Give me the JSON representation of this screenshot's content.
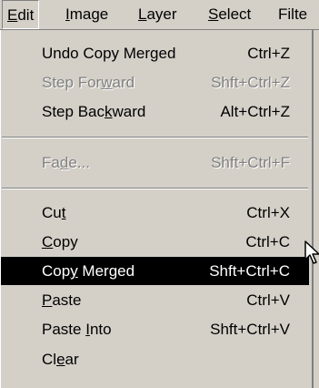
{
  "menubar": {
    "items": [
      {
        "label": "Edit",
        "pre": "",
        "key": "E",
        "post": "dit"
      },
      {
        "label": "Image",
        "pre": "",
        "key": "I",
        "post": "mage"
      },
      {
        "label": "Layer",
        "pre": "",
        "key": "L",
        "post": "ayer"
      },
      {
        "label": "Select",
        "pre": "",
        "key": "S",
        "post": "elect"
      },
      {
        "label": "Filter",
        "pre": "",
        "key": "",
        "post": "Filte"
      }
    ]
  },
  "edit_menu": {
    "items": [
      {
        "label": "Undo Copy Merged",
        "pre": "Undo Copy Merged",
        "key": "",
        "post": "",
        "shortcut": "Ctrl+Z",
        "state": "enabled"
      },
      {
        "label": "Step Forward",
        "pre": "Step For",
        "key": "w",
        "post": "ard",
        "shortcut": "Shft+Ctrl+Z",
        "state": "disabled"
      },
      {
        "label": "Step Backward",
        "pre": "Step Bac",
        "key": "k",
        "post": "ward",
        "shortcut": "Alt+Ctrl+Z",
        "state": "enabled"
      },
      {
        "label": "Fade...",
        "pre": "Fa",
        "key": "d",
        "post": "e...",
        "shortcut": "Shft+Ctrl+F",
        "state": "disabled"
      },
      {
        "label": "Cut",
        "pre": "Cu",
        "key": "t",
        "post": "",
        "shortcut": "Ctrl+X",
        "state": "enabled"
      },
      {
        "label": "Copy",
        "pre": "",
        "key": "C",
        "post": "opy",
        "shortcut": "Ctrl+C",
        "state": "enabled"
      },
      {
        "label": "Copy Merged",
        "pre": "Cop",
        "key": "y",
        "post": " Merged",
        "shortcut": "Shft+Ctrl+C",
        "state": "highlighted"
      },
      {
        "label": "Paste",
        "pre": "",
        "key": "P",
        "post": "aste",
        "shortcut": "Ctrl+V",
        "state": "enabled"
      },
      {
        "label": "Paste Into",
        "pre": "Paste ",
        "key": "I",
        "post": "nto",
        "shortcut": "Shft+Ctrl+V",
        "state": "enabled"
      },
      {
        "label": "Clear",
        "pre": "Cl",
        "key": "e",
        "post": "ar",
        "shortcut": "",
        "state": "enabled"
      }
    ]
  },
  "colors": {
    "menu_background": "#d4d0c8",
    "highlight_background": "#000000",
    "highlight_text": "#ffffff",
    "disabled_text": "#808080"
  },
  "icons": {
    "pointer": "arrow-cursor-icon"
  }
}
